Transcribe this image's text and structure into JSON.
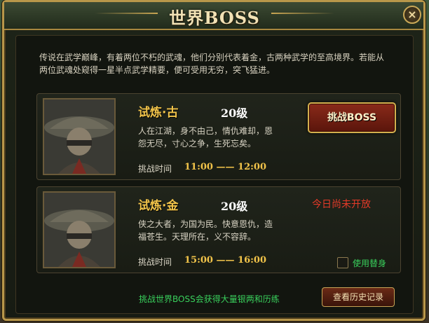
{
  "window": {
    "title": "世界BOSS",
    "close_symbol": "×"
  },
  "intro": "传说在武学巅峰，有着两位不朽的武魂，他们分别代表着金，古两种武学的至高境界。若能从两位武魂处窥得一星半点武学精要，便可受用无穷，突飞猛进。",
  "bosses": [
    {
      "name": "试炼·古",
      "level": "20级",
      "description": "人在江湖，身不由己，情仇难却，恩怨无尽，寸心之争，生死忘矣。",
      "time_label": "挑战时间",
      "time_range": "11:00 —— 12:00",
      "action_label": "挑战BOSS"
    },
    {
      "name": "试炼·金",
      "level": "20级",
      "description": "侠之大者，为国为民。快意恩仇，造福苍生。天理所在，义不容辞。",
      "time_label": "挑战时间",
      "time_range": "15:00 —— 16:00",
      "status": "今日尚未开放",
      "substitute_label": "使用替身"
    }
  ],
  "footer": {
    "reward_text": "挑战世界BOSS会获得大量银两和历练",
    "history_label": "查看历史记录"
  },
  "colors": {
    "gold": "#f2c44a",
    "green": "#39d05c",
    "red": "#e43a28"
  }
}
